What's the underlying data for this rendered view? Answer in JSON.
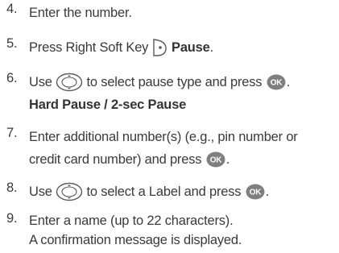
{
  "steps": [
    {
      "number": "4.",
      "text": "Enter the number."
    },
    {
      "number": "5.",
      "prefix": "Press Right Soft Key",
      "bold": "Pause",
      "suffix": ".",
      "icon": "right-soft-key-icon"
    },
    {
      "number": "6.",
      "line1_prefix": "Use",
      "line1_mid": "to select pause type and press",
      "line1_suffix": ".",
      "line2_bold": "Hard Pause / 2-sec Pause",
      "icons": [
        "navigation-key-icon",
        "ok-key-icon"
      ]
    },
    {
      "number": "7.",
      "line1": "Enter additional number(s) (e.g., pin number or",
      "line2_prefix": "credit card number) and press",
      "line2_suffix": ".",
      "icon": "ok-key-icon"
    },
    {
      "number": "8.",
      "prefix": "Use",
      "mid": "to select a Label and press",
      "suffix": ".",
      "icons": [
        "navigation-key-icon",
        "ok-key-icon"
      ]
    },
    {
      "number": "9.",
      "line1": "Enter a name (up to 22 characters).",
      "line2": "A confirmation message is displayed."
    }
  ],
  "ok_key_label": "OK",
  "colors": {
    "text": "#3a3a3a",
    "ok_key_fill": "#7f7f7f",
    "icon_stroke": "#5a5a5a"
  }
}
